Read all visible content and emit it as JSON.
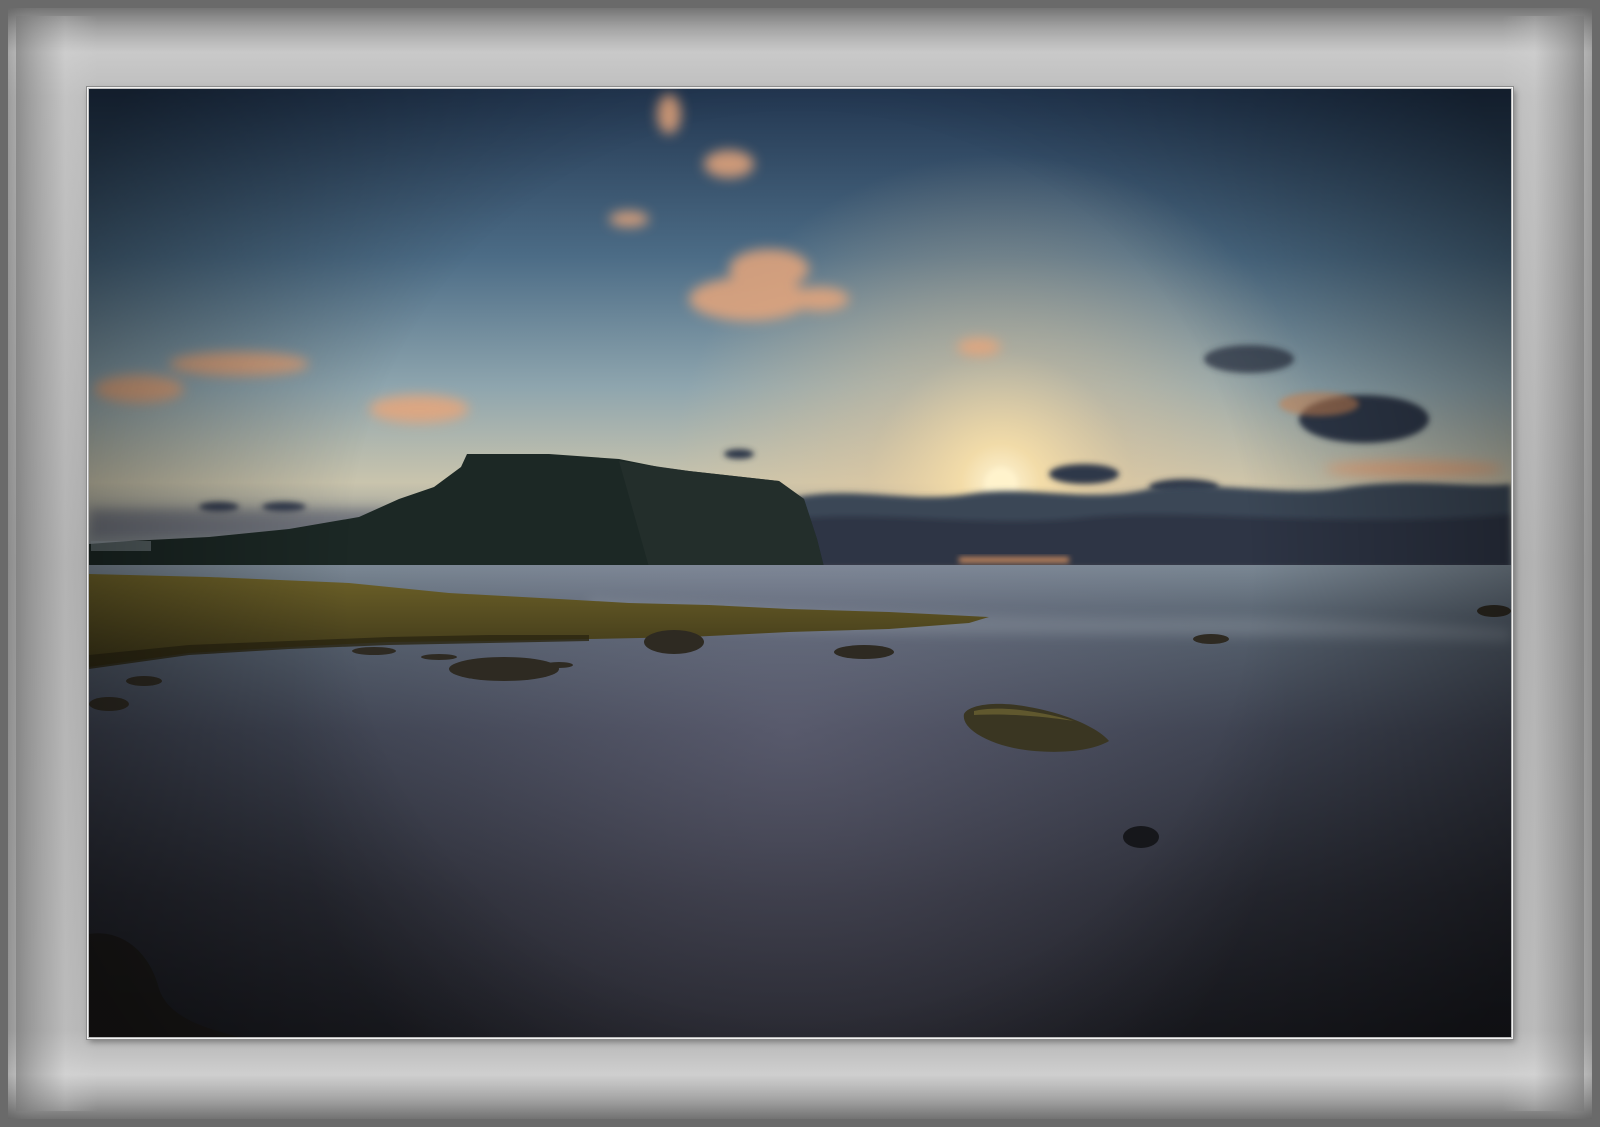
{
  "image": {
    "subject": "seascape",
    "colors": {
      "sky_top": "#263b52",
      "sky_mid": "#5f7f96",
      "sky_glow": "#f3d9a6",
      "sun": "#fff2c8",
      "cloud_warm": "#e9a274",
      "cloud_dark": "#2f3a4a",
      "headland": "#1e2a26",
      "sea_far": "#6f7f8d",
      "sea_near": "#24272f",
      "rock_flat": "#5a5023",
      "frame": "#b8b8b8"
    }
  }
}
